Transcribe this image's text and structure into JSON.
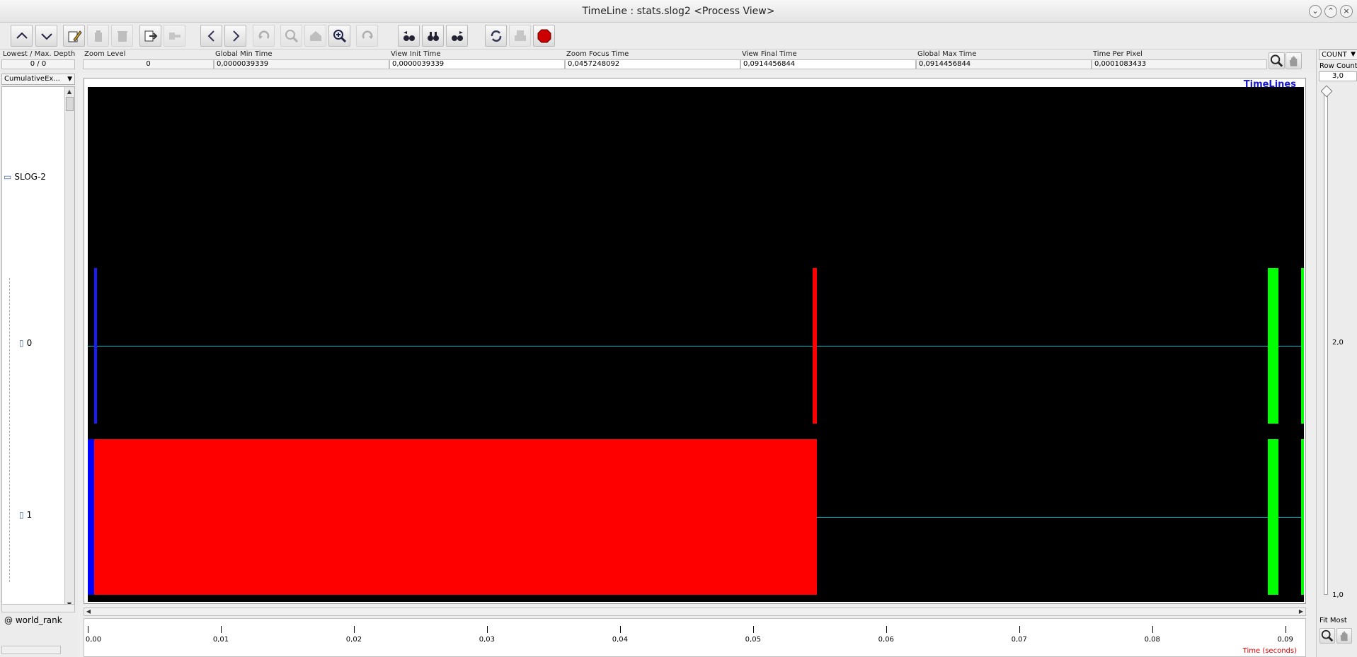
{
  "window": {
    "title": "TimeLine : stats.slog2  <Process View>"
  },
  "toolbar": {
    "buttons": [
      {
        "icon": "scroll-up-icon"
      },
      {
        "icon": "scroll-down-icon"
      },
      {
        "icon": "edit-icon"
      },
      {
        "icon": "delete-icon"
      },
      {
        "icon": "trash-icon"
      },
      {
        "icon": "export-icon"
      },
      {
        "icon": "import-icon"
      },
      {
        "icon": "back-icon"
      },
      {
        "icon": "forward-icon"
      },
      {
        "icon": "undo-icon"
      },
      {
        "icon": "zoom-out-icon"
      },
      {
        "icon": "home-icon"
      },
      {
        "icon": "zoom-in-icon"
      },
      {
        "icon": "redo-icon"
      },
      {
        "icon": "search-backward-icon"
      },
      {
        "icon": "search-icon"
      },
      {
        "icon": "search-forward-icon"
      },
      {
        "icon": "refresh-icon"
      },
      {
        "icon": "print-icon"
      },
      {
        "icon": "stop-icon"
      }
    ]
  },
  "info": {
    "depth_label": "Lowest / Max. Depth",
    "depth_value": "0 / 0",
    "zoom_level_label": "Zoom Level",
    "zoom_level_value": "0",
    "global_min_label": "Global Min Time",
    "global_min_value": "0,0000039339",
    "view_init_label": "View  Init Time",
    "view_init_value": "0,0000039339",
    "zoom_focus_label": "Zoom Focus Time",
    "zoom_focus_value": "0,0457248092",
    "view_final_label": "View Final Time",
    "view_final_value": "0,0914456844",
    "global_max_label": "Global Max Time",
    "global_max_value": "0,0914456844",
    "time_per_pixel_label": "Time Per Pixel",
    "time_per_pixel_value": "0,0001083433"
  },
  "tree": {
    "combo_value": "CumulativeEx...",
    "root_label": "SLOG-2",
    "rows": [
      "0",
      "1"
    ],
    "bottom_label": "@ world_rank"
  },
  "canvas": {
    "title": "TimeLines",
    "background": "#000000",
    "line_color": "#00b8c8",
    "colors": {
      "red": "#ff0000",
      "blue": "#0000ff",
      "green": "#00ff00"
    },
    "rows": [
      {
        "id": "0",
        "states": [
          {
            "start": 0.0005,
            "end": 0.0007,
            "color": "#1a1aff"
          },
          {
            "start": 0.0545,
            "end": 0.0548,
            "color": "#ff0000"
          },
          {
            "start": 0.0887,
            "end": 0.0895,
            "color": "#00ff00"
          },
          {
            "start": 0.0912,
            "end": 0.0918,
            "color": "#00ff00"
          }
        ]
      },
      {
        "id": "1",
        "states": [
          {
            "start": 0.0,
            "end": 0.0005,
            "color": "#0000ff"
          },
          {
            "start": 0.0005,
            "end": 0.0548,
            "color": "#ff0000"
          },
          {
            "start": 0.0887,
            "end": 0.0895,
            "color": "#00ff00"
          },
          {
            "start": 0.0912,
            "end": 0.0918,
            "color": "#00ff00"
          }
        ]
      }
    ],
    "view_start": 0.0,
    "view_end": 0.0914
  },
  "ruler": {
    "ticks": [
      "0,00",
      "0,01",
      "0,02",
      "0,03",
      "0,04",
      "0,05",
      "0,06",
      "0,07",
      "0,08",
      "0,09"
    ],
    "tick_values": [
      0.0,
      0.01,
      0.02,
      0.03,
      0.04,
      0.05,
      0.06,
      0.07,
      0.08,
      0.09
    ],
    "unit_label": "Time (seconds)"
  },
  "right": {
    "combo_value": "COUNT",
    "row_count_label": "Row Count",
    "row_count_value": "3,0",
    "tick_top": "2,0",
    "tick_bottom": "1,0",
    "fit_label": "Fit Most"
  }
}
